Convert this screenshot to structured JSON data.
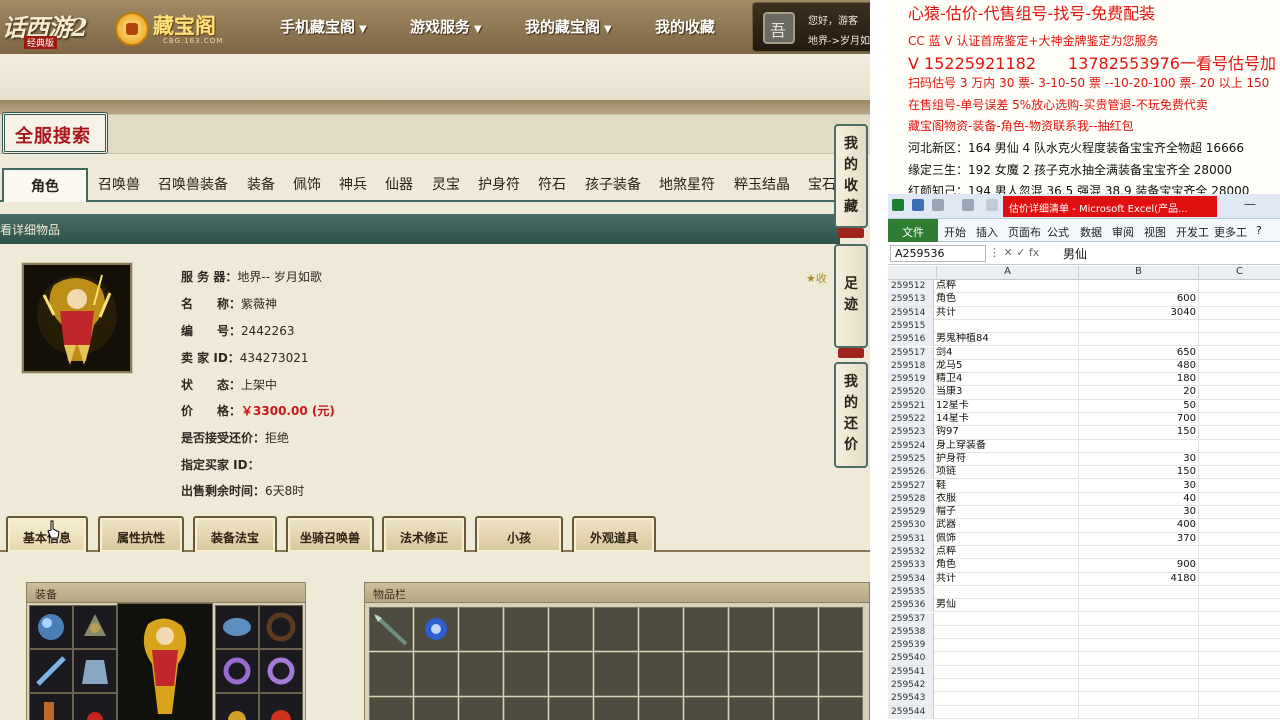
{
  "site": {
    "logo_game_text": "话西游2",
    "logo_game_sub": "经典版",
    "logo_cbg_text": "藏宝阁",
    "logo_cbg_sub": "CBG.163.COM",
    "nav": [
      {
        "label": "手机藏宝阁",
        "has_caret": true
      },
      {
        "label": "游戏服务",
        "has_caret": true
      },
      {
        "label": "我的藏宝阁",
        "has_caret": true
      },
      {
        "label": "我的收藏",
        "has_caret": false
      }
    ],
    "user": {
      "greeting": "您好，游客",
      "server": "地界->岁月如"
    },
    "search_title": "全服搜索",
    "categories": [
      "角色",
      "召唤兽",
      "召唤兽装备",
      "装备",
      "佩饰",
      "神兵",
      "仙器",
      "灵宝",
      "护身符",
      "符石",
      "孩子装备",
      "地煞星符",
      "粹玉结晶",
      "宝石"
    ],
    "detail_bar": "看详细物品",
    "info": [
      {
        "label": "服 务 器：",
        "value": "地界-- 岁月如歌"
      },
      {
        "label": "名　　称：",
        "value": "紫薇神"
      },
      {
        "label": "编　　号：",
        "value": "2442263"
      },
      {
        "label": "卖 家  ID：",
        "value": "434273021"
      },
      {
        "label": "状　　态：",
        "value": "上架中"
      },
      {
        "label": "价　　格：",
        "value": "￥3300.00 (元)",
        "is_price": true
      },
      {
        "label": "是否接受还价：",
        "value": "拒绝"
      },
      {
        "label": "指定买家 ID：",
        "value": ""
      },
      {
        "label": "出售剩余时间：",
        "value": "6天8时"
      }
    ],
    "fav_hint": "收",
    "side_tabs": [
      "我的收藏",
      "足迹",
      "我的还价"
    ],
    "sub_tabs": [
      "基本信息",
      "属性抗性",
      "装备法宝",
      "坐骑召唤兽",
      "法术修正",
      "小孩",
      "外观道具"
    ],
    "equip_panel_title": "装备",
    "bag_panel_title": "物品栏"
  },
  "notes": {
    "lines": [
      {
        "text": "心猿-估价-代售组号-找号-免费配装",
        "style": "red big"
      },
      {
        "text": "CC 蓝 V 认证首席鉴定+大神金牌鉴定为您服务",
        "style": "red"
      },
      {
        "text": "V 15225921182　　13782553976一看号估号加 V",
        "style": "red big"
      },
      {
        "text": "扫码估号 3 万内 30 票- 3-10-50 票  --10-20-100 票- 20 以上 150",
        "style": "red"
      },
      {
        "text": "在售组号-单号误差 5%放心选购-买贵管退-不玩免费代卖",
        "style": "red"
      },
      {
        "text": "藏宝阁物资-装备-角色-物资联系我--抽红包",
        "style": "red"
      },
      {
        "text": "河北新区：164 男仙 4 队水克火程度装备宝宝齐全物超 16666",
        "style": "black"
      },
      {
        "text": "缘定三生：192 女魔 2 孩子克水抽全满装备宝宝齐全 28000",
        "style": "black"
      },
      {
        "text": "红颜知己：194 男人忽混 36.5 强混 38.9 装备宝宝齐全 28000",
        "style": "black"
      }
    ]
  },
  "excel": {
    "title": "估价详细清单 - Microsoft Excel(产品...",
    "ribbon_tabs": [
      "文件",
      "开始",
      "插入",
      "页面布",
      "公式",
      "数据",
      "审阅",
      "视图",
      "开发工",
      "更多工"
    ],
    "name_box": "A259536",
    "formula_value": "男仙",
    "columns": [
      "A",
      "B",
      "C"
    ],
    "rows": [
      {
        "n": "259512",
        "a": "点粹",
        "b": ""
      },
      {
        "n": "259513",
        "a": "角色",
        "b": "600"
      },
      {
        "n": "259514",
        "a": "共计",
        "b": "3040"
      },
      {
        "n": "259515",
        "a": "",
        "b": ""
      },
      {
        "n": "259516",
        "a": "男鬼种植84",
        "b": ""
      },
      {
        "n": "259517",
        "a": "剑4",
        "b": "650"
      },
      {
        "n": "259518",
        "a": "龙马5",
        "b": "480"
      },
      {
        "n": "259519",
        "a": "精卫4",
        "b": "180"
      },
      {
        "n": "259520",
        "a": "当康3",
        "b": "20"
      },
      {
        "n": "259521",
        "a": "12星卡",
        "b": "50"
      },
      {
        "n": "259522",
        "a": "14星卡",
        "b": "700"
      },
      {
        "n": "259523",
        "a": "钩97",
        "b": "150"
      },
      {
        "n": "259524",
        "a": "身上穿装备",
        "b": ""
      },
      {
        "n": "259525",
        "a": "护身符",
        "b": "30"
      },
      {
        "n": "259526",
        "a": "项链",
        "b": "150"
      },
      {
        "n": "259527",
        "a": "鞋",
        "b": "30"
      },
      {
        "n": "259528",
        "a": "衣服",
        "b": "40"
      },
      {
        "n": "259529",
        "a": "帽子",
        "b": "30"
      },
      {
        "n": "259530",
        "a": "武器",
        "b": "400"
      },
      {
        "n": "259531",
        "a": "佩饰",
        "b": "370"
      },
      {
        "n": "259532",
        "a": "点粹",
        "b": ""
      },
      {
        "n": "259533",
        "a": "角色",
        "b": "900"
      },
      {
        "n": "259534",
        "a": "共计",
        "b": "4180"
      },
      {
        "n": "259535",
        "a": "",
        "b": ""
      },
      {
        "n": "259536",
        "a": "男仙",
        "b": ""
      },
      {
        "n": "259537",
        "a": "",
        "b": ""
      },
      {
        "n": "259538",
        "a": "",
        "b": ""
      },
      {
        "n": "259539",
        "a": "",
        "b": ""
      },
      {
        "n": "259540",
        "a": "",
        "b": ""
      },
      {
        "n": "259541",
        "a": "",
        "b": ""
      },
      {
        "n": "259542",
        "a": "",
        "b": ""
      },
      {
        "n": "259543",
        "a": "",
        "b": ""
      },
      {
        "n": "259544",
        "a": "",
        "b": ""
      }
    ]
  }
}
